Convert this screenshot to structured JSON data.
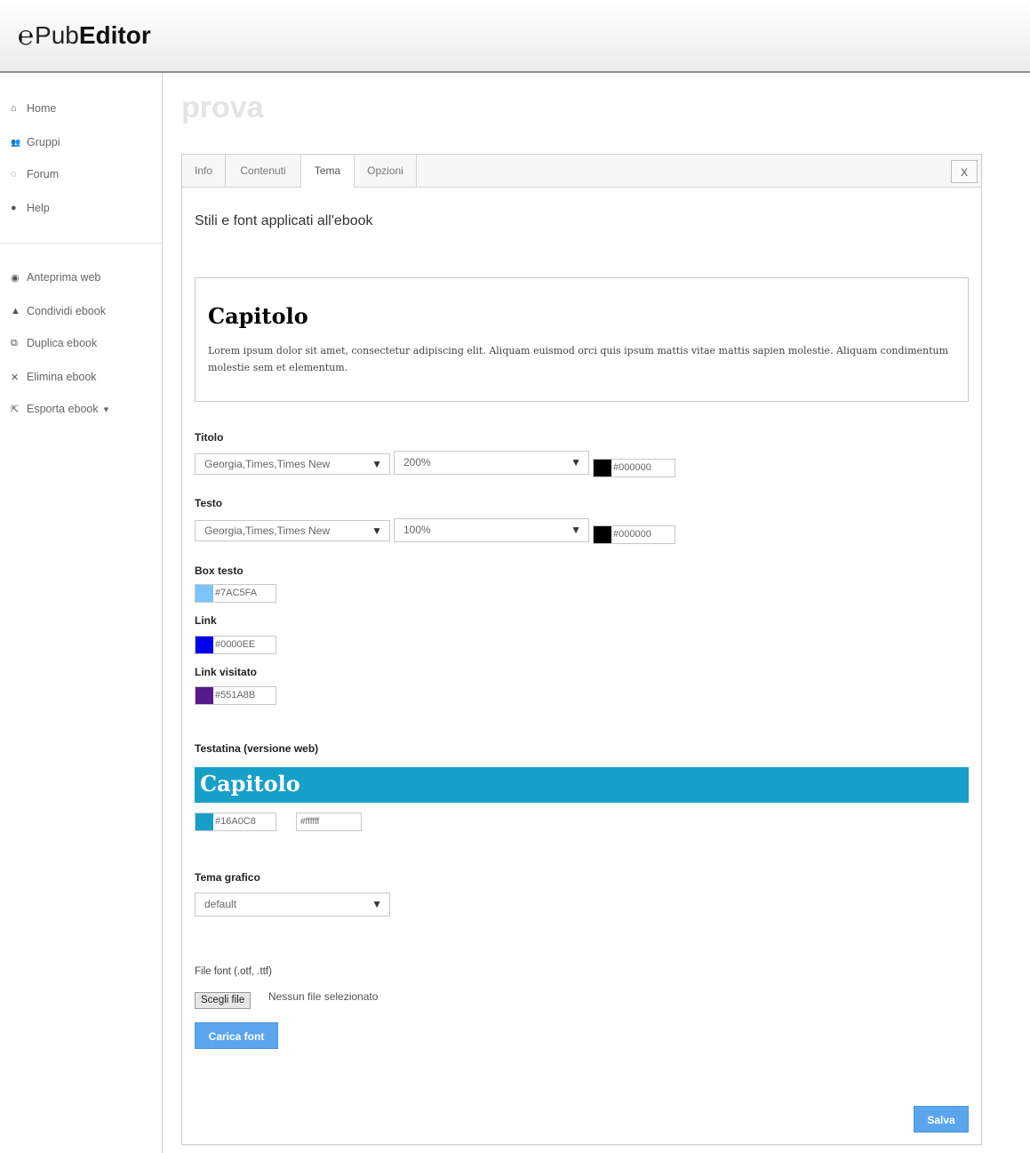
{
  "app": {
    "logo_mark": "℮",
    "logo_pub": "Pub",
    "logo_editor": "Editor"
  },
  "sidebar": {
    "items": [
      {
        "icon": "home-icon",
        "glyph": "⌂",
        "label": "Home"
      },
      {
        "icon": "users-icon",
        "glyph": "👥",
        "label": "Gruppi"
      },
      {
        "icon": "chat-icon",
        "glyph": "◌",
        "label": "Forum"
      },
      {
        "icon": "help-icon",
        "glyph": "●",
        "label": "Help"
      },
      {
        "icon": "eye-icon",
        "glyph": "◉",
        "label": "Anteprima web"
      },
      {
        "icon": "user-icon",
        "glyph": "▲",
        "label": "Condividi ebook"
      },
      {
        "icon": "copy-icon",
        "glyph": "⧉",
        "label": "Duplica ebook"
      },
      {
        "icon": "delete-icon",
        "glyph": "✕",
        "label": "Elimina ebook"
      },
      {
        "icon": "export-icon",
        "glyph": "⇱",
        "label": "Esporta ebook"
      }
    ],
    "export_caret": "▾"
  },
  "page": {
    "title": "prova"
  },
  "tabs": [
    {
      "label": "Info"
    },
    {
      "label": "Contenuti"
    },
    {
      "label": "Tema"
    },
    {
      "label": "Opzioni"
    }
  ],
  "active_tab": "Tema",
  "close_label": "X",
  "theme": {
    "subtitle": "Stili e font applicati all'ebook",
    "preview": {
      "title": "Capitolo",
      "text": "Lorem ipsum dolor sit amet, consectetur adipiscing elit. Aliquam euismod orci quis ipsum mattis vitae mattis sapien molestie. Aliquam condimentum molestie sem et elementum."
    },
    "titolo": {
      "label": "Titolo",
      "font": "Georgia,Times,Times New",
      "size": "200%",
      "color": "#000000"
    },
    "testo": {
      "label": "Testo",
      "font": "Georgia,Times,Times New",
      "size": "100%",
      "color": "#000000"
    },
    "box_testo": {
      "label": "Box testo",
      "color": "#7AC5FA"
    },
    "link": {
      "label": "Link",
      "color": "#0000EE"
    },
    "link_visitato": {
      "label": "Link visitato",
      "color": "#551A8B"
    },
    "testatina": {
      "label": "Testatina (versione web)",
      "title": "Capitolo",
      "bg_color": "#16A0C8",
      "text_color": "#ffffff"
    },
    "tema_grafico": {
      "label": "Tema grafico",
      "value": "default"
    },
    "font_file": {
      "label": "File font (.otf, .ttf)",
      "choose_label": "Scegli file",
      "status": "Nessun file selezionato",
      "upload_label": "Carica font"
    },
    "save_label": "Salva"
  },
  "arrow_glyph": "▼"
}
